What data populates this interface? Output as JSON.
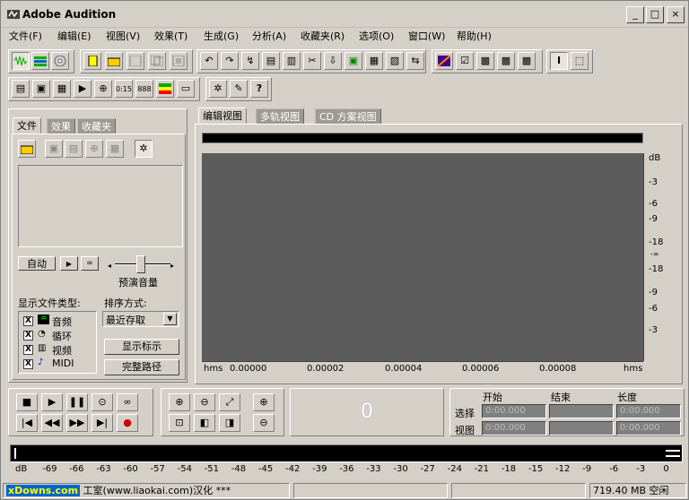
{
  "app": {
    "title": "Adobe Audition",
    "icon": "audition-logo-icon"
  },
  "window_controls": {
    "minimize": "_",
    "maximize": "□",
    "close": "×"
  },
  "menu": [
    "文件(F)",
    "编辑(E)",
    "视图(V)",
    "效果(T)",
    "生成(G)",
    "分析(A)",
    "收藏夹(R)",
    "选项(O)",
    "窗口(W)",
    "帮助(H)"
  ],
  "left_panel": {
    "tabs": [
      "文件",
      "效果",
      "收藏夹"
    ],
    "auto_btn": "自动",
    "play_btn": "▶",
    "loop_btn": "∞",
    "preview_volume": "预演音量",
    "file_types_label": "显示文件类型:",
    "file_types": [
      {
        "label": "音频",
        "checked": "X"
      },
      {
        "label": "循环",
        "checked": "X"
      },
      {
        "label": "视频",
        "checked": "X"
      },
      {
        "label": "MIDI",
        "checked": "X"
      }
    ],
    "sort_label": "排序方式:",
    "sort_value": "最近存取",
    "show_hint_btn": "显示标示",
    "full_path_btn": "完整路径"
  },
  "views": {
    "tabs": [
      "编辑视图",
      "多轨视图",
      "CD 方案视图"
    ]
  },
  "ruler": {
    "unit": "dB",
    "labels": [
      "-3",
      "-6",
      "-9",
      "-18",
      "-∞",
      "-18",
      "-9",
      "-6",
      "-3"
    ]
  },
  "timeline": {
    "unit_left": "hms",
    "unit_right": "hms",
    "labels": [
      "0.00000",
      "0.00002",
      "0.00004",
      "0.00006",
      "0.00008"
    ]
  },
  "time_display": "0",
  "selection": {
    "headers": [
      "开始",
      "结束",
      "长度"
    ],
    "row1_label": "选择",
    "row2_label": "视图",
    "row1": [
      "0:00.000",
      "",
      "0:00.000"
    ],
    "row2": [
      "0:00.000",
      "",
      "0:00.000"
    ]
  },
  "meter": {
    "labels": [
      "dB",
      "-69",
      "-66",
      "-63",
      "-60",
      "-57",
      "-54",
      "-51",
      "-48",
      "-45",
      "-42",
      "-39",
      "-36",
      "-33",
      "-30",
      "-27",
      "-24",
      "-21",
      "-18",
      "-15",
      "-12",
      "-9",
      "-6",
      "-3",
      "0"
    ]
  },
  "status": {
    "left": "xDowns.com",
    "credit": "工室(www.liaokai.com)汉化 ***",
    "free": "719.40 MB 空闲"
  }
}
